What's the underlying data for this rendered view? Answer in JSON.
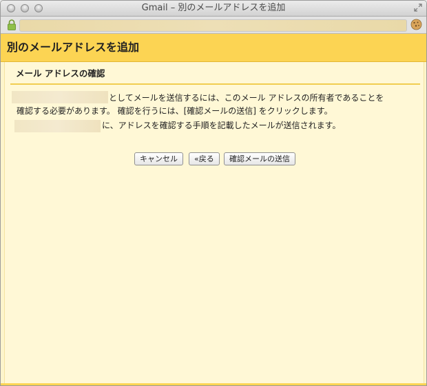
{
  "window": {
    "title": "Gmail – 別のメールアドレスを追加"
  },
  "header": {
    "title": "別のメールアドレスを追加"
  },
  "section": {
    "title": "メール アドレスの確認"
  },
  "message": {
    "line1": "としてメールを送信するには、このメール アドレスの所有者であることを",
    "line2": "確認する必要があります。 確認を行うには、[確認メールの送信] をクリックします。",
    "line3": "に、アドレスを確認する手順を記載したメールが送信されます。"
  },
  "buttons": {
    "cancel": "キャンセル",
    "back": "«戻る",
    "send": "確認メールの送信"
  },
  "colors": {
    "header": "#fcd453",
    "panel": "#fff8d6",
    "rule": "#f1cd4f"
  },
  "icons": [
    "close-button-icon",
    "minimize-button-icon",
    "zoom-button-icon",
    "fullscreen-icon",
    "lock-icon",
    "cookie-icon"
  ]
}
